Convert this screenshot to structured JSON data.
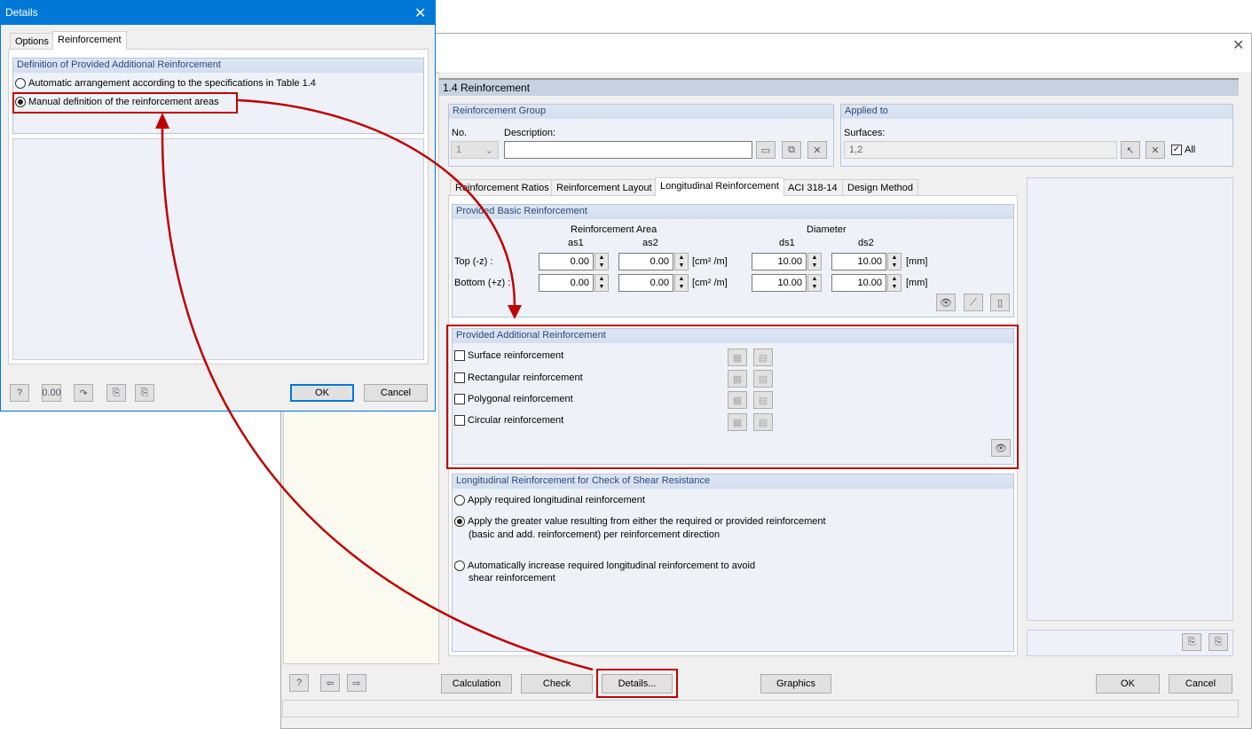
{
  "main": {
    "header": "1.4 Reinforcement",
    "reinforcement_group": {
      "title": "Reinforcement Group",
      "no_label": "No.",
      "no_value": "1",
      "description_label": "Description:",
      "description_value": ""
    },
    "applied_to": {
      "title": "Applied to",
      "surfaces_label": "Surfaces:",
      "surfaces_value": "1,2",
      "all_label": "All",
      "all_checked": true
    },
    "tabs": [
      {
        "label": "Reinforcement Ratios"
      },
      {
        "label": "Reinforcement Layout"
      },
      {
        "label": "Longitudinal Reinforcement",
        "active": true
      },
      {
        "label": "ACI 318-14"
      },
      {
        "label": "Design Method"
      }
    ],
    "basic": {
      "title": "Provided Basic Reinforcement",
      "area_header": "Reinforcement Area",
      "diameter_header": "Diameter",
      "as1": "as1",
      "as2": "as2",
      "ds1": "ds1",
      "ds2": "ds2",
      "rows": [
        {
          "label": "Top (-z) :",
          "as1": "0.00",
          "as2": "0.00",
          "unit_area": "[cm² /m]",
          "ds1": "10.00",
          "ds2": "10.00",
          "unit_d": "[mm]"
        },
        {
          "label": "Bottom (+z) :",
          "as1": "0.00",
          "as2": "0.00",
          "unit_area": "[cm² /m]",
          "ds1": "10.00",
          "ds2": "10.00",
          "unit_d": "[mm]"
        }
      ]
    },
    "additional": {
      "title": "Provided Additional Reinforcement",
      "items": [
        {
          "label": "Surface reinforcement",
          "checked": false
        },
        {
          "label": "Rectangular reinforcement",
          "checked": false
        },
        {
          "label": "Polygonal reinforcement",
          "checked": false
        },
        {
          "label": "Circular reinforcement",
          "checked": false
        }
      ]
    },
    "shear": {
      "title": "Longitudinal Reinforcement for Check of Shear Resistance",
      "options": [
        {
          "label": "Apply required longitudinal reinforcement",
          "selected": false
        },
        {
          "label": "Apply the greater value resulting from either the required or provided reinforcement",
          "label2": "(basic and add. reinforcement) per reinforcement direction",
          "selected": true
        },
        {
          "label": "Automatically increase required longitudinal reinforcement to avoid",
          "label2": "shear reinforcement",
          "selected": false
        }
      ]
    },
    "buttons": {
      "calculation": "Calculation",
      "check": "Check",
      "details": "Details...",
      "graphics": "Graphics",
      "ok": "OK",
      "cancel": "Cancel"
    }
  },
  "details": {
    "title": "Details",
    "tabs": [
      {
        "label": "Options"
      },
      {
        "label": "Reinforcement",
        "active": true
      }
    ],
    "group_title": "Definition of Provided Additional Reinforcement",
    "options": [
      {
        "label": "Automatic arrangement according to the specifications in Table 1.4",
        "selected": false
      },
      {
        "label": "Manual definition of the reinforcement areas",
        "selected": true
      }
    ],
    "ok": "OK",
    "cancel": "Cancel"
  },
  "colors": {
    "accent": "#0078d7",
    "highlight": "#c00000"
  }
}
